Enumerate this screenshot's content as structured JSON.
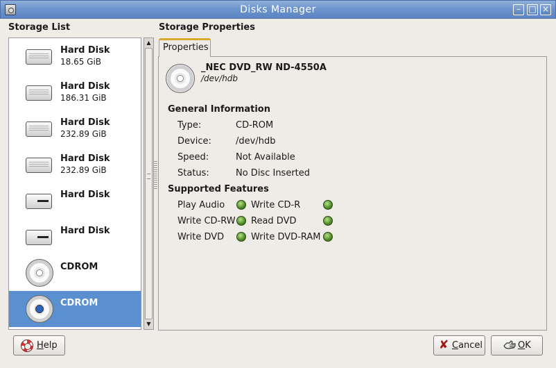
{
  "window": {
    "title": "Disks Manager",
    "min_glyph": "–",
    "max_glyph": "□",
    "close_glyph": "×"
  },
  "storage_list": {
    "label": "Storage List",
    "items": [
      {
        "name": "Hard Disk",
        "size": "18.65 GiB",
        "icon": "hard-disk-icon"
      },
      {
        "name": "Hard Disk",
        "size": "186.31 GiB",
        "icon": "hard-disk-icon"
      },
      {
        "name": "Hard Disk",
        "size": "232.89 GiB",
        "icon": "hard-disk-icon"
      },
      {
        "name": "Hard Disk",
        "size": "232.89 GiB",
        "icon": "hard-disk-icon"
      },
      {
        "name": "Hard Disk",
        "size": "",
        "icon": "removable-disk-icon"
      },
      {
        "name": "Hard Disk",
        "size": "",
        "icon": "removable-disk-icon"
      },
      {
        "name": "CDROM",
        "size": "",
        "icon": "cdrom-icon"
      },
      {
        "name": "CDROM",
        "size": "",
        "icon": "cdrom-icon",
        "selected": true
      }
    ],
    "scroll_up": "▲",
    "scroll_down": "▼"
  },
  "properties": {
    "label": "Storage Properties",
    "tab": "Properties",
    "device_name": "_NEC DVD_RW ND-4550A",
    "device_path": "/dev/hdb",
    "general": {
      "title": "General Information",
      "rows": [
        {
          "label": "Type:",
          "value": "CD-ROM"
        },
        {
          "label": "Device:",
          "value": "/dev/hdb"
        },
        {
          "label": "Speed:",
          "value": "Not Available"
        },
        {
          "label": "Status:",
          "value": "No Disc Inserted"
        }
      ]
    },
    "features": {
      "title": "Supported Features",
      "items": [
        {
          "label": "Play Audio",
          "status": "on"
        },
        {
          "label": "Write CD-R",
          "status": "on"
        },
        {
          "label": "Write CD-RW",
          "status": "on"
        },
        {
          "label": "Read DVD",
          "status": "on"
        },
        {
          "label": "Write DVD",
          "status": "on"
        },
        {
          "label": "Write DVD-RAM",
          "status": "on"
        }
      ]
    }
  },
  "buttons": {
    "help": {
      "mnemonic": "H",
      "rest": "elp"
    },
    "cancel": {
      "mnemonic": "C",
      "rest": "ancel"
    },
    "ok": {
      "mnemonic": "O",
      "rest": "K"
    }
  },
  "colors": {
    "selection": "#5a8fd0",
    "titlebar": "#6e95cc",
    "led_on": "#4e8a26"
  }
}
